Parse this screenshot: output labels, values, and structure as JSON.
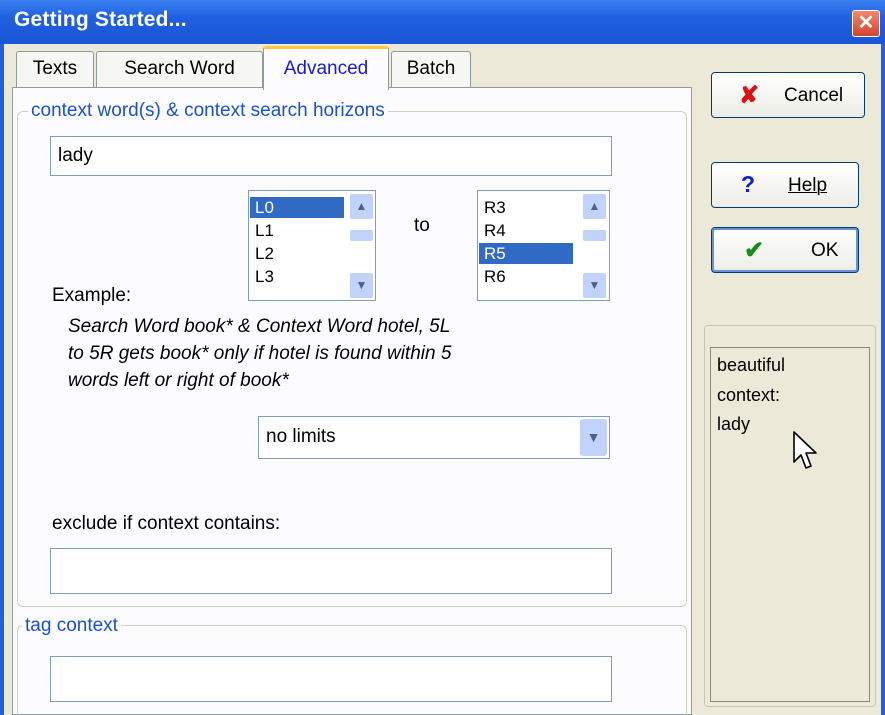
{
  "window": {
    "title": "Getting Started...",
    "close_glyph": "✕"
  },
  "tabs": [
    {
      "label": "Texts",
      "active": false
    },
    {
      "label": "Search Word",
      "active": false
    },
    {
      "label": "Advanced",
      "active": true
    },
    {
      "label": "Batch",
      "active": false
    }
  ],
  "context_group": {
    "legend": "context word(s) & context search horizons",
    "context_word_value": "lady",
    "left_horizon": {
      "items": [
        "L0",
        "L1",
        "L2",
        "L3"
      ],
      "selected": "L0"
    },
    "to_label": "to",
    "right_horizon": {
      "items": [
        "R3",
        "R4",
        "R5",
        "R6"
      ],
      "selected": "R5"
    },
    "example_label": "Example:",
    "example_lines": [
      "Search Word book* & Context Word hotel, 5L",
      "to 5R gets book* only if hotel is found within 5",
      "words left or right of book*"
    ],
    "limit_select_value": "no limits",
    "exclude_label": "exclude if context contains:",
    "exclude_value": ""
  },
  "tag_group": {
    "legend": "tag context",
    "value": ""
  },
  "buttons": {
    "cancel": {
      "label": "Cancel",
      "icon": "red-x-icon",
      "color": "#e01010"
    },
    "help": {
      "label": "Help",
      "icon": "question-mark-icon",
      "color": "#1020d0"
    },
    "ok": {
      "label": "OK",
      "icon": "green-check-icon",
      "color": "#1a8a1a"
    }
  },
  "preview": {
    "lines": [
      "beautiful",
      "context:",
      "lady"
    ]
  },
  "colors": {
    "titlebar": "#1f5fe0",
    "selection": "#316ac5",
    "legend": "#1a50d4"
  }
}
